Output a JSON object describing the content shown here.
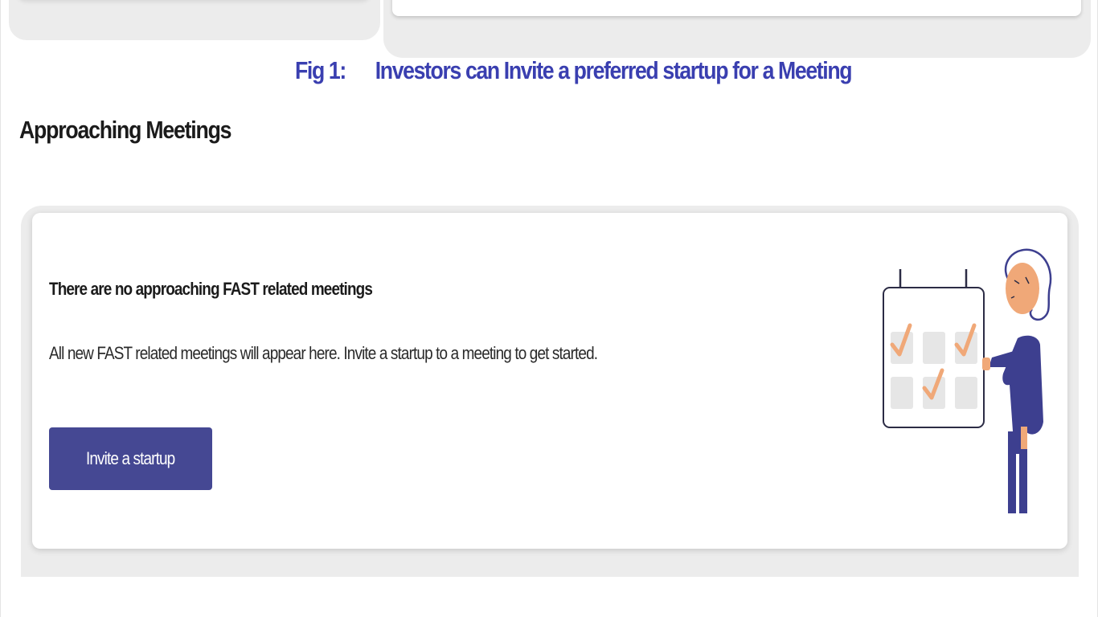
{
  "caption": {
    "fig_label": "Fig 1:",
    "text": "Investors can Invite a preferred startup for a Meeting",
    "color": "#3a3fb0"
  },
  "section": {
    "title": "Approaching Meetings"
  },
  "empty_state": {
    "title": "There are no approaching FAST related meetings",
    "description": "All new FAST related meetings will appear here. Invite a startup to a meeting to get started.",
    "button_label": "Invite a startup",
    "illustration": "person-checking-calendar-illustration"
  },
  "colors": {
    "primary_button": "#454893",
    "illustration_accent": "#f0a878",
    "illustration_figure": "#3d3f8f",
    "card_shell": "#ececec"
  }
}
